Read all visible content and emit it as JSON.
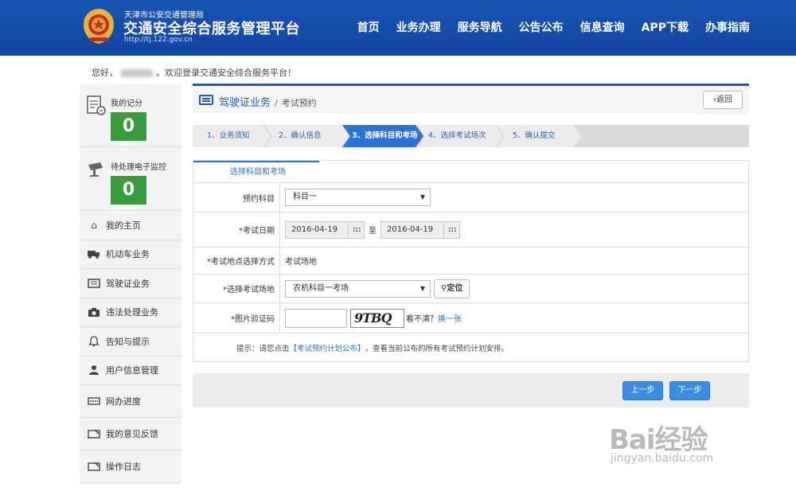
{
  "header": {
    "org": "天津市公安交通管理局",
    "title": "交通安全综合服务管理平台",
    "url": "http://tj.122.gov.cn",
    "nav": [
      "首页",
      "业务办理",
      "服务导航",
      "公告公布",
      "信息查询",
      "APP下载",
      "办事指南"
    ]
  },
  "welcome": {
    "prefix": "您好，",
    "suffix": "。欢迎登录交通安全综合服务平台！"
  },
  "sidebar": {
    "score_label": "我的记分",
    "score_value": "0",
    "monitor_label": "待处理电子监控",
    "monitor_value": "0",
    "menu": [
      {
        "label": "我的主页",
        "icon": "home-icon"
      },
      {
        "label": "机动车业务",
        "icon": "truck-icon"
      },
      {
        "label": "驾驶证业务",
        "icon": "license-icon"
      },
      {
        "label": "违法处理业务",
        "icon": "camera-icon"
      },
      {
        "label": "告知与提示",
        "icon": "bell-icon"
      },
      {
        "label": "用户信息管理",
        "icon": "user-icon"
      },
      {
        "label": "网办进度",
        "icon": "progress-icon"
      },
      {
        "label": "我的意见反馈",
        "icon": "feedback-icon"
      },
      {
        "label": "操作日志",
        "icon": "log-icon"
      }
    ]
  },
  "main": {
    "section": "驾驶证业务",
    "page": "考试预约",
    "back": "返回",
    "steps": [
      "1、业务须知",
      "2、确认信息",
      "3、选择科目和考场",
      "4、选择考试场次",
      "5、确认提交"
    ],
    "active_step": 2,
    "panel_tab": "选择科目和考场",
    "form": {
      "subject_label": "预约科目",
      "subject_value": "科目一",
      "date_label": "*考试日期",
      "date_from": "2016-04-19",
      "date_to_text": "至",
      "date_to": "2016-04-19",
      "method_label": "*考试地点选择方式",
      "method_value": "考试场地",
      "venue_label": "*选择考试场地",
      "venue_value": "农机科目一考场",
      "locate": "定位",
      "captcha_label": "*图片验证码",
      "captcha_text": "9TBQ",
      "captcha_hint": "看不清？",
      "captcha_refresh": "换一张",
      "tip_prefix": "提示：请您点击",
      "tip_link": "【考试预约计划公布】",
      "tip_suffix": "，查看当前公布的所有考试预约计划安排。"
    },
    "prev": "上一步",
    "next": "下一步"
  },
  "watermark": {
    "main": "Bai经验",
    "sub": "jingyan.baidu.com"
  },
  "colors": {
    "header_blue": "#1a55b3",
    "active_step": "#2a72d6",
    "score_green": "#3b9a3e",
    "button_blue": "#3a8de0"
  }
}
